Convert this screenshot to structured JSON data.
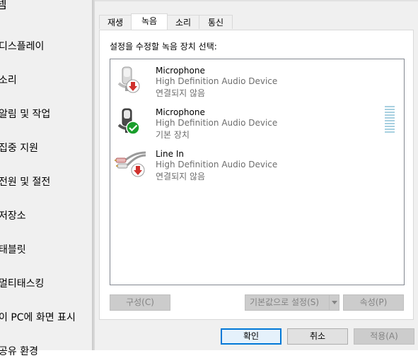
{
  "sidebar": {
    "title": "템",
    "items": [
      "디스플레이",
      "소리",
      "알림 및 작업",
      "집중 지원",
      "전원 및 절전",
      "저장소",
      "태블릿",
      "멀티태스킹",
      "이 PC에 화면 표시",
      "공유 환경"
    ]
  },
  "dialog": {
    "tabs": [
      "재생",
      "녹음",
      "소리",
      "통신"
    ],
    "active_tab": "녹음",
    "instruction": "설정을 수정할 녹음 장치 선택:",
    "devices": [
      {
        "name": "Microphone",
        "description": "High Definition Audio Device",
        "status": "연결되지 않음",
        "icon": "microphone-icon",
        "badge": "disconnected-down-arrow-icon"
      },
      {
        "name": "Microphone",
        "description": "High Definition Audio Device",
        "status": "기본 장치",
        "icon": "microphone-icon",
        "badge": "default-check-icon"
      },
      {
        "name": "Line In",
        "description": "High Definition Audio Device",
        "status": "연결되지 않음",
        "icon": "line-in-cable-icon",
        "badge": "disconnected-down-arrow-icon"
      }
    ],
    "buttons": {
      "configure": "구성(C)",
      "set_default": "기본값으로 설정(S)",
      "properties": "속성(P)",
      "ok": "확인",
      "cancel": "취소",
      "apply": "적용(A)"
    }
  },
  "colors": {
    "accent": "#0078d7",
    "check_badge": "#1a9e2c",
    "disconnect_badge": "#d0312d"
  }
}
